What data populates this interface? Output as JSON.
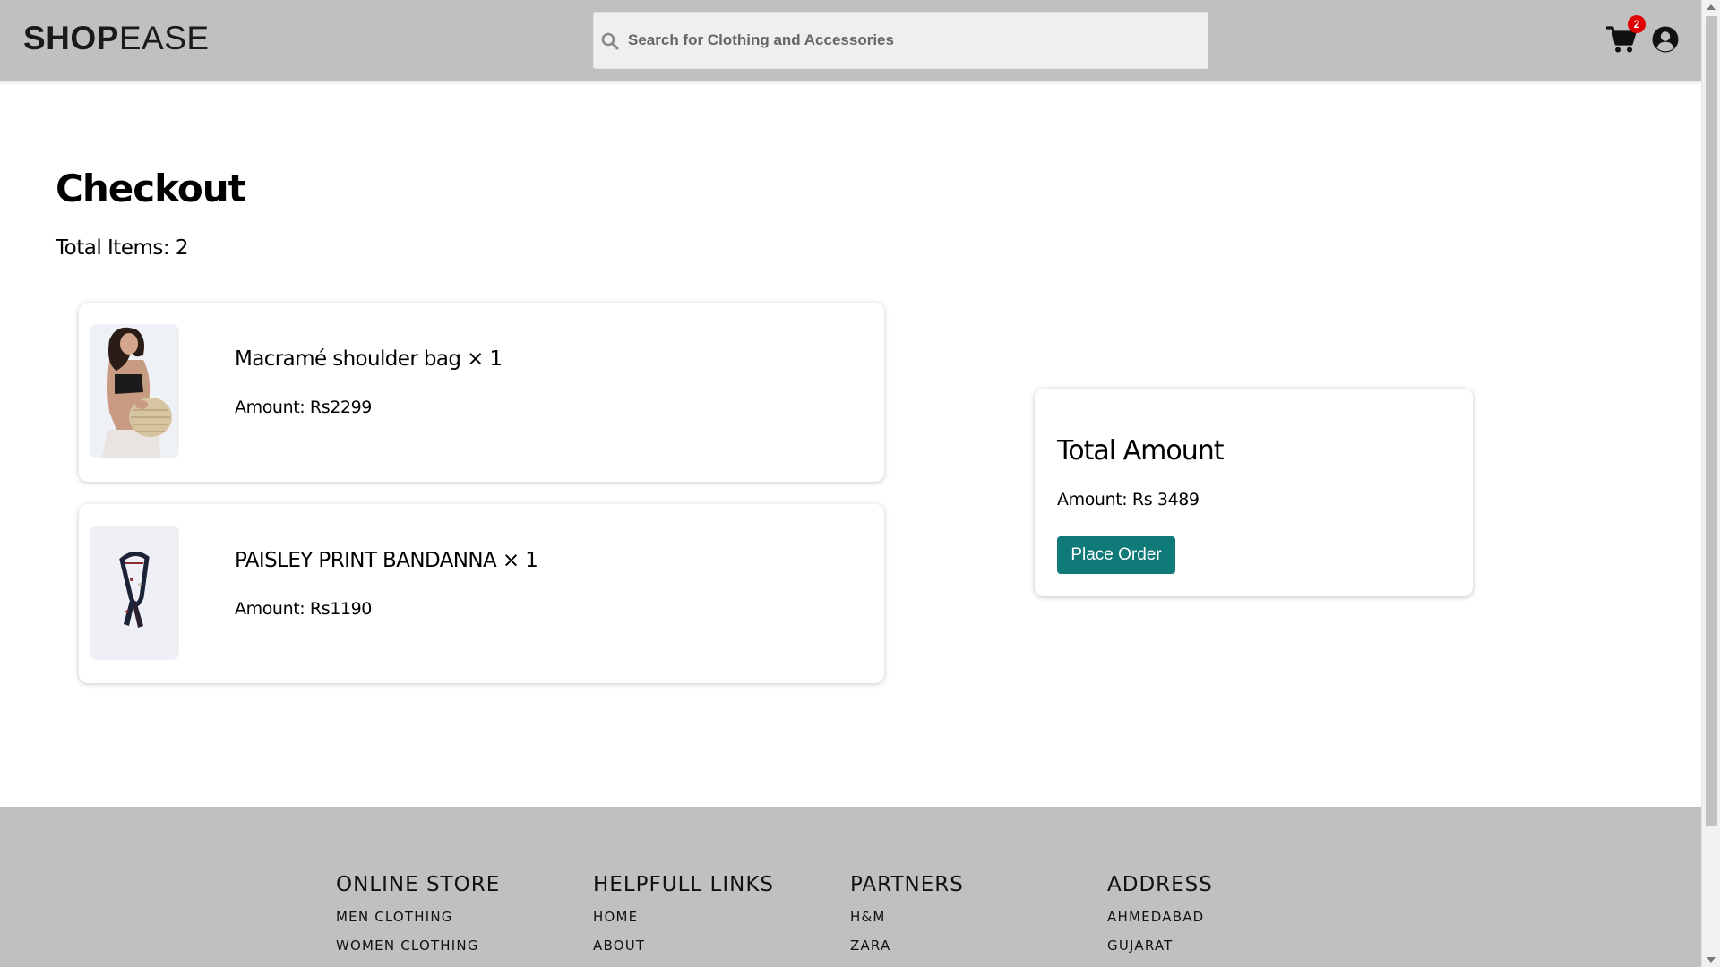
{
  "header": {
    "logo_bold": "SHOP",
    "logo_light": "EASE",
    "search_placeholder": "Search for Clothing and Accessories",
    "cart_count": "2"
  },
  "checkout": {
    "title": "Checkout",
    "total_items": "Total Items: 2",
    "items": [
      {
        "name": "Macramé shoulder bag × 1",
        "amount": "Amount: Rs2299",
        "image": "woman-with-macrame-bag"
      },
      {
        "name": "PAISLEY PRINT BANDANNA × 1",
        "amount": "Amount: Rs1190",
        "image": "paisley-bandanna"
      }
    ]
  },
  "summary": {
    "title": "Total Amount",
    "amount": "Amount: Rs 3489",
    "button_label": "Place Order",
    "button_color": "#0f7a78"
  },
  "footer": {
    "columns": [
      {
        "heading": "ONLINE STORE",
        "links": [
          "MEN CLOTHING",
          "WOMEN CLOTHING"
        ]
      },
      {
        "heading": "HELPFULL LINKS",
        "links": [
          "HOME",
          "ABOUT"
        ]
      },
      {
        "heading": "PARTNERS",
        "links": [
          "H&M",
          "ZARA"
        ]
      },
      {
        "heading": "ADDRESS",
        "links": [
          "AHMEDABAD",
          "GUJARAT"
        ]
      }
    ]
  },
  "colors": {
    "header_bg": "#c0c0c0",
    "badge": "#e10000",
    "accent": "#0f7a78"
  }
}
